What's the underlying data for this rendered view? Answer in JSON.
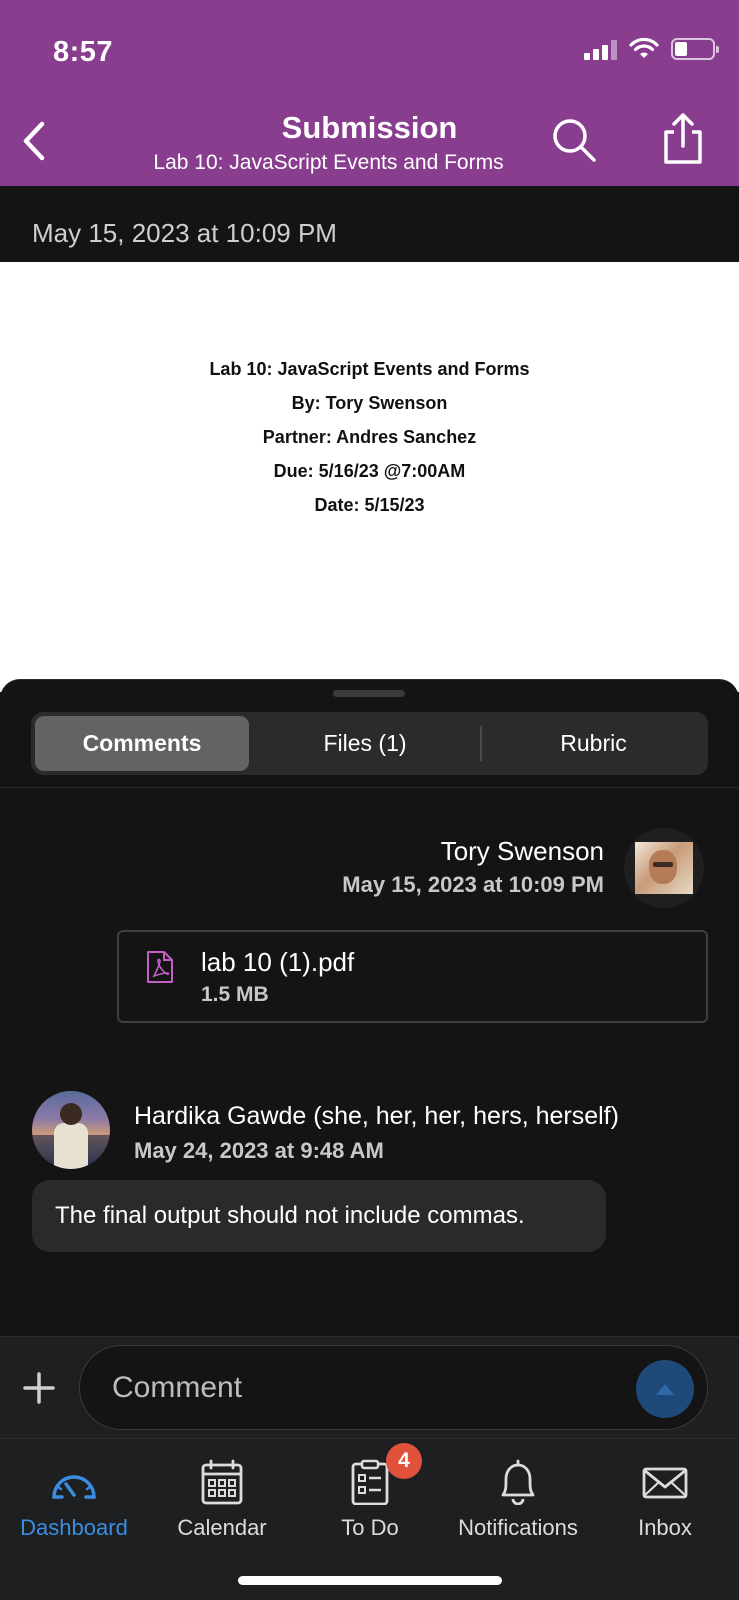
{
  "status_bar": {
    "time": "8:57"
  },
  "header": {
    "title": "Submission",
    "subtitle": "Lab 10: JavaScript Events and Forms",
    "back_icon": "chevron-left-icon",
    "search_icon": "search-icon",
    "share_icon": "share-icon",
    "background_color": "#883d8f"
  },
  "submission_date": "May 15, 2023 at 10:09 PM",
  "document": {
    "lines": [
      "Lab 10: JavaScript Events and Forms",
      "By: Tory Swenson",
      "Partner: Andres Sanchez",
      "Due: 5/16/23 @7:00AM",
      "Date: 5/15/23"
    ]
  },
  "tabs": [
    {
      "label": "Comments",
      "active": true
    },
    {
      "label": "Files (1)",
      "active": false
    },
    {
      "label": "Rubric",
      "active": false
    }
  ],
  "comments": [
    {
      "author": "Tory Swenson",
      "date": "May 15, 2023 at 10:09 PM",
      "attachment": {
        "name": "lab 10  (1).pdf",
        "size": "1.5 MB",
        "icon": "pdf-icon"
      }
    },
    {
      "author": "Hardika Gawde (she, her, her, hers, herself)",
      "date": "May 24, 2023 at 9:48 AM",
      "message": "The final output should not include commas."
    }
  ],
  "composer": {
    "placeholder": "Comment",
    "add_icon": "plus-icon",
    "send_icon": "send-arrow-icon"
  },
  "tab_bar": {
    "items": [
      {
        "label": "Dashboard",
        "icon": "dashboard-gauge-icon",
        "active": true
      },
      {
        "label": "Calendar",
        "icon": "calendar-icon",
        "active": false
      },
      {
        "label": "To Do",
        "icon": "todo-clipboard-icon",
        "active": false,
        "badge": "4"
      },
      {
        "label": "Notifications",
        "icon": "bell-icon",
        "active": false
      },
      {
        "label": "Inbox",
        "icon": "envelope-icon",
        "active": false
      }
    ],
    "active_color": "#3a8de0"
  }
}
